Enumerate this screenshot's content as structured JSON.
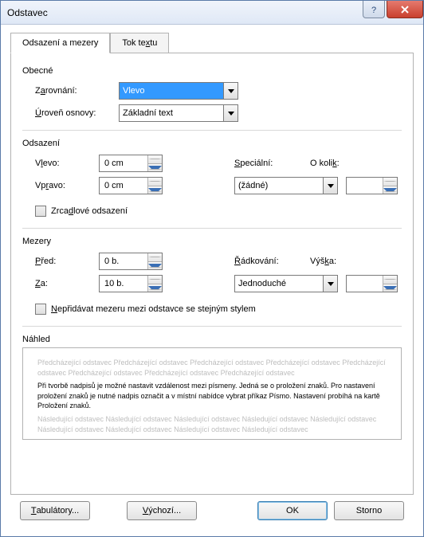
{
  "title": "Odstavec",
  "tabs": {
    "indent": "Odsazení a mezery",
    "flow_prefix": "Tok te",
    "flow_acc": "x",
    "flow_suffix": "tu"
  },
  "general": {
    "label": "Obecné",
    "alignment_prefix": "Z",
    "alignment_acc": "a",
    "alignment_suffix": "rovnání:",
    "alignment_value": "Vlevo",
    "outline_acc": "Ú",
    "outline_suffix": "roveň osnovy:",
    "outline_value": "Základní text"
  },
  "indent": {
    "label": "Odsazení",
    "left_prefix": "V",
    "left_acc": "l",
    "left_suffix": "evo:",
    "left_value": "0 cm",
    "right_prefix": "Vp",
    "right_acc": "r",
    "right_suffix": "avo:",
    "right_value": "0 cm",
    "special_acc": "S",
    "special_suffix": "peciální:",
    "special_value": "(žádné)",
    "by_prefix": "O koli",
    "by_acc": "k",
    "by_suffix": ":",
    "by_value": "",
    "mirror_prefix": "Zrca",
    "mirror_acc": "d",
    "mirror_suffix": "lové odsazení"
  },
  "spacing": {
    "label": "Mezery",
    "before_acc": "P",
    "before_suffix": "řed:",
    "before_value": "0 b.",
    "after_acc": "Z",
    "after_suffix": "a:",
    "after_value": "10 b.",
    "line_acc": "Ř",
    "line_suffix": "ádkování:",
    "line_value": "Jednoduché",
    "at_prefix": "Výš",
    "at_acc": "k",
    "at_suffix": "a:",
    "at_value": "",
    "nosame_acc": "N",
    "nosame_suffix": "epřidávat mezeru mezi odstavce se stejným stylem"
  },
  "preview": {
    "label": "Náhled",
    "before": "Předcházející odstavec Předcházející odstavec Předcházející odstavec Předcházející odstavec Předcházející odstavec Předcházející odstavec Předcházející odstavec Předcházející odstavec",
    "sample": "Při tvorbě nadpisů je možné nastavit vzdálenost mezi písmeny. Jedná se o proložení znaků. Pro nastavení proložení znaků je nutné nadpis označit a v místní nabídce vybrat příkaz Písmo. Nastavení probíhá na kartě Proložení znaků.",
    "after": "Následující odstavec Následující odstavec Následující odstavec Následující odstavec Následující odstavec Následující odstavec Následující odstavec Následující odstavec Následující odstavec"
  },
  "buttons": {
    "tabs_acc": "T",
    "tabs_suffix": "abulátory...",
    "default_acc": "V",
    "default_suffix": "ýchozí...",
    "ok": "OK",
    "cancel": "Storno"
  }
}
